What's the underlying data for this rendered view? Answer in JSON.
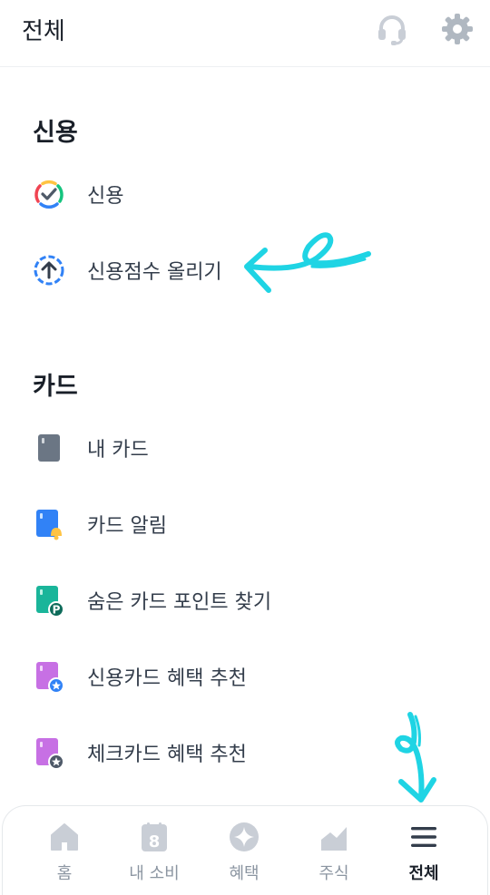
{
  "header": {
    "title": "전체",
    "support_icon": "headset-icon",
    "settings_icon": "gear-icon"
  },
  "sections": [
    {
      "title": "신용",
      "items": [
        {
          "label": "신용",
          "icon": "credit-gauge-icon"
        },
        {
          "label": "신용점수 올리기",
          "icon": "arrow-up-circle-icon"
        }
      ]
    },
    {
      "title": "카드",
      "items": [
        {
          "label": "내 카드",
          "icon": "card-icon"
        },
        {
          "label": "카드 알림",
          "icon": "card-bell-icon"
        },
        {
          "label": "숨은 카드 포인트 찾기",
          "icon": "card-point-icon"
        },
        {
          "label": "신용카드 혜택 추천",
          "icon": "card-star-icon"
        },
        {
          "label": "체크카드 혜택 추천",
          "icon": "card-star-dark-icon"
        }
      ]
    }
  ],
  "tabbar": {
    "tabs": [
      {
        "label": "홈",
        "icon": "home-icon"
      },
      {
        "label": "내 소비",
        "icon": "calendar-icon",
        "badge": "8"
      },
      {
        "label": "혜택",
        "icon": "benefit-star-icon"
      },
      {
        "label": "주식",
        "icon": "chart-icon"
      },
      {
        "label": "전체",
        "icon": "menu-icon",
        "active": true
      }
    ]
  },
  "colors": {
    "accent_annotation": "#1fd4e4",
    "text_primary": "#191f28",
    "text_secondary": "#333d4b",
    "tab_inactive": "#8b95a1",
    "icon_gray": "#c9ced6"
  }
}
